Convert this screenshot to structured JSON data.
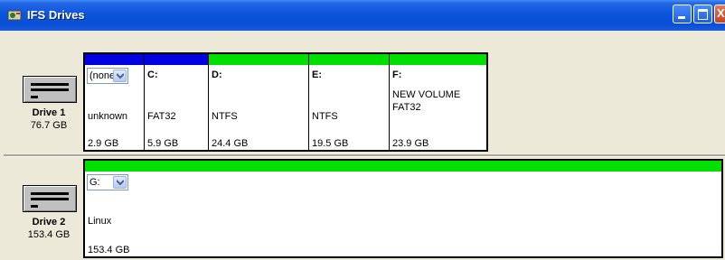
{
  "window": {
    "title": "IFS Drives"
  },
  "colors": {
    "blue_bar": "#0000e0",
    "green_bar": "#00e000"
  },
  "drives": [
    {
      "name": "Drive 1",
      "size": "76.7 GB",
      "partitions": [
        {
          "letter": "(none)",
          "is_dropdown": true,
          "label": "",
          "fs": "unknown",
          "size": "2.9 GB",
          "bar_color": "blue_bar"
        },
        {
          "letter": "C:",
          "label": "",
          "fs": "FAT32",
          "size": "5.9 GB",
          "bar_color": "blue_bar"
        },
        {
          "letter": "D:",
          "label": "",
          "fs": "NTFS",
          "size": "24.4 GB",
          "bar_color": "green_bar"
        },
        {
          "letter": "E:",
          "label": "",
          "fs": "NTFS",
          "size": "19.5 GB",
          "bar_color": "green_bar"
        },
        {
          "letter": "F:",
          "label": "NEW VOLUME",
          "fs": "FAT32",
          "size": "23.9 GB",
          "bar_color": "green_bar"
        }
      ]
    },
    {
      "name": "Drive 2",
      "size": "153.4 GB",
      "partitions": [
        {
          "letter": "G:",
          "is_dropdown": true,
          "label": "",
          "fs": "Linux",
          "size": "153.4 GB",
          "bar_color": "green_bar"
        }
      ]
    }
  ]
}
